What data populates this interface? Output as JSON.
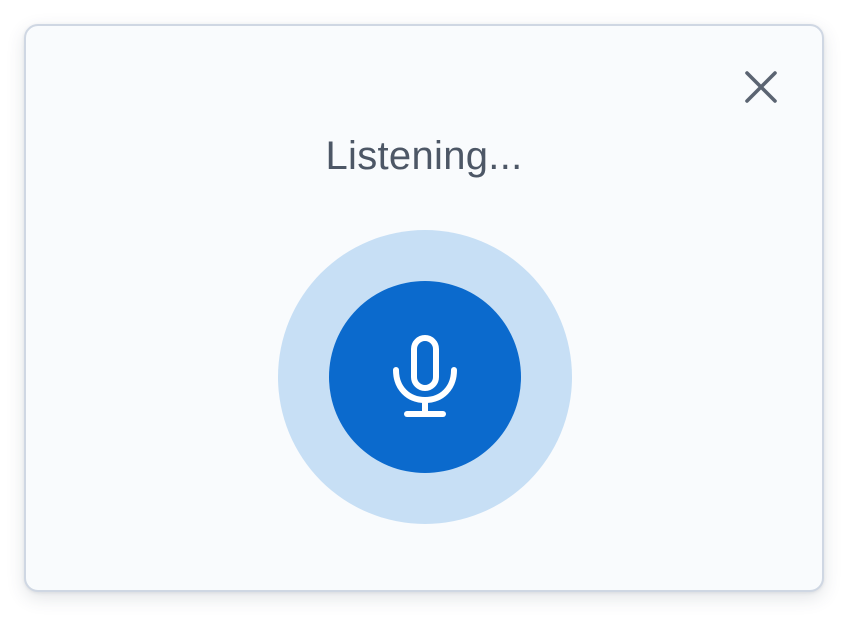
{
  "dialog": {
    "title": "Listening...",
    "close_icon": "close-icon",
    "mic_icon": "microphone-icon"
  },
  "colors": {
    "dialog_background": "#f9fbfd",
    "dialog_border": "#cfd7e3",
    "title_text": "#4d5766",
    "close_icon": "#5b6472",
    "mic_halo": "#c7dff5",
    "mic_button": "#0b6acd",
    "mic_icon": "#ffffff"
  }
}
